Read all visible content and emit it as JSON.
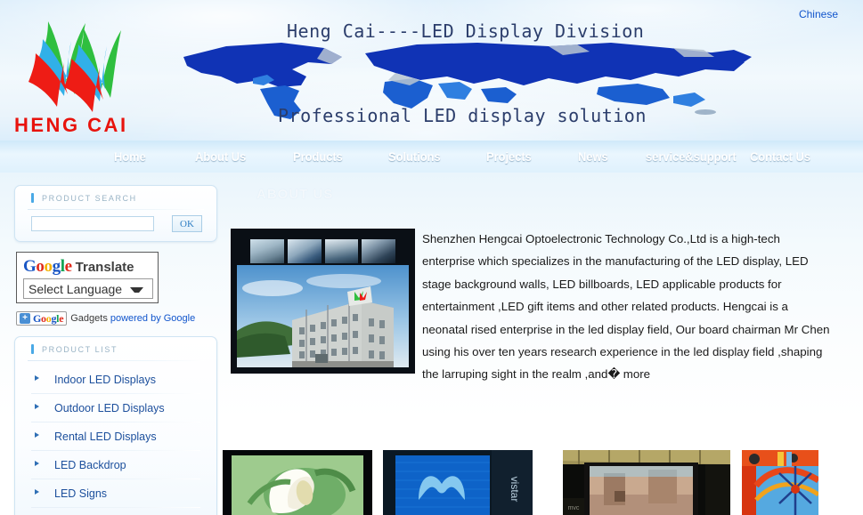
{
  "header": {
    "logo_text": "HENG CAI",
    "chinese_link": "Chinese",
    "title_line1": "Heng Cai----LED Display Division",
    "title_line2": "Professional LED display solution"
  },
  "nav": {
    "items": [
      {
        "label": "Home"
      },
      {
        "label": "About Us"
      },
      {
        "label": "Products"
      },
      {
        "label": "Solutions"
      },
      {
        "label": "Projects"
      },
      {
        "label": "News"
      },
      {
        "label": "service&support"
      },
      {
        "label": "Contact Us"
      }
    ]
  },
  "sidebar": {
    "search": {
      "title": "PRODUCT SEARCH",
      "value": "",
      "placeholder": "",
      "button_label": "OK"
    },
    "translate": {
      "brand_g": "G",
      "brand_o1": "o",
      "brand_o2": "o",
      "brand_g2": "g",
      "brand_l": "l",
      "brand_e": "e",
      "word": "Translate",
      "selected_language": "Select Language"
    },
    "gadgets": {
      "plus": "+",
      "brand_g": "G",
      "brand_o1": "o",
      "brand_o2": "o",
      "brand_g2": "g",
      "brand_l": "l",
      "brand_e": "e",
      "label": "Gadgets",
      "link": "powered by Google"
    },
    "product_list": {
      "title": "PRODUCT LIST",
      "items": [
        {
          "label": "Indoor LED Displays"
        },
        {
          "label": "Outdoor LED Displays"
        },
        {
          "label": "Rental LED Displays"
        },
        {
          "label": "LED Backdrop"
        },
        {
          "label": "LED Signs"
        }
      ]
    }
  },
  "main": {
    "heading": "ABOUT US",
    "about_text": "Shenzhen Hengcai Optoelectronic Technology Co.,Ltd is a high-tech enterprise  which specializes in the manufacturing of the  LED display, LED stage background walls, LED billboards, LED applicable products for entertainment ,LED gift items and other related products. Hengcai is  a neonatal rised enterprise  in the led display field, Our board chairman Mr Chen using his over ten years research experience in the led display field ,shaping the larruping sight in the  realm ,and� more"
  },
  "colors": {
    "nav_blue": "#1f95de",
    "logo_red": "#e8130d",
    "logo_green": "#2fbf3f",
    "logo_blue": "#31b0e8",
    "link_blue": "#1155cc",
    "list_link": "#1c4f9c",
    "map_blue": "#1033b5"
  }
}
